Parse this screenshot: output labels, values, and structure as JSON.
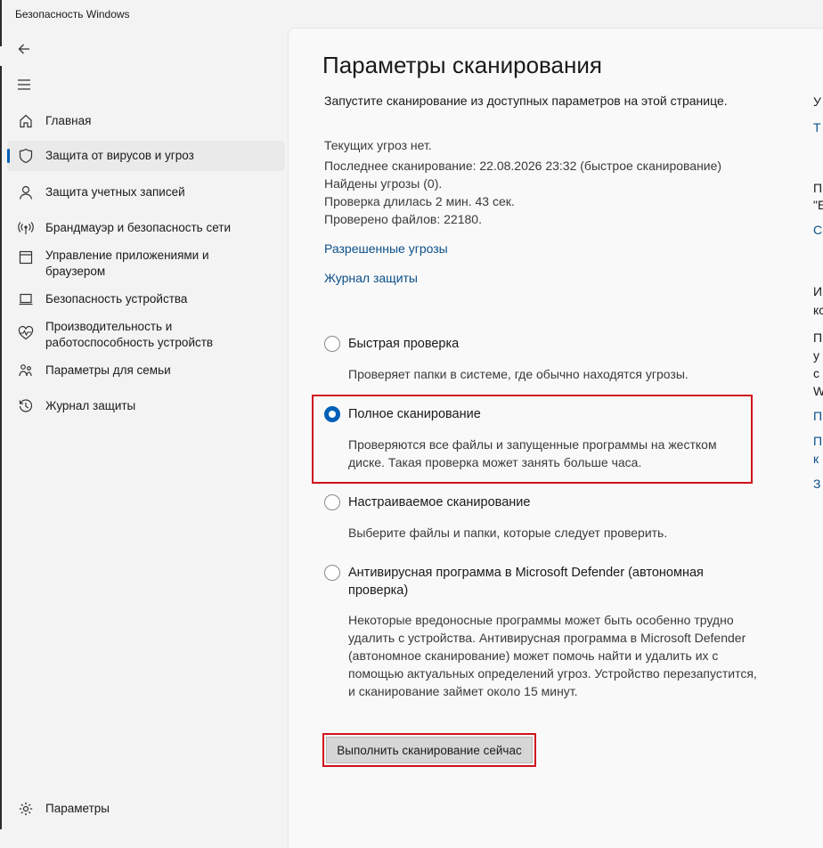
{
  "window": {
    "title": "Безопасность Windows"
  },
  "toolbar": {
    "back_icon": "back-arrow-icon",
    "menu_icon": "hamburger-menu-icon"
  },
  "sidebar": {
    "items": [
      {
        "label": "Главная",
        "icon": "home-icon"
      },
      {
        "label": "Защита от вирусов и угроз",
        "icon": "shield-icon",
        "selected": true
      },
      {
        "label": "Защита учетных записей",
        "icon": "person-icon"
      },
      {
        "label": "Брандмауэр и безопасность сети",
        "icon": "wifi-antenna-icon"
      },
      {
        "label": "Управление приложениями и браузером",
        "icon": "app-browser-icon"
      },
      {
        "label": "Безопасность устройства",
        "icon": "laptop-icon"
      },
      {
        "label": "Производительность и работоспособность устройств",
        "icon": "heart-pulse-icon"
      },
      {
        "label": "Параметры для семьи",
        "icon": "family-icon"
      },
      {
        "label": "Журнал защиты",
        "icon": "history-icon"
      }
    ],
    "settings_label": "Параметры"
  },
  "main": {
    "title": "Параметры сканирования",
    "intro": "Запустите сканирование из доступных параметров на этой странице.",
    "status": [
      "Текущих угроз нет.",
      "Последнее сканирование: 22.08.2026 23:32 (быстрое сканирование)",
      "Найдены угрозы (0).",
      "Проверка длилась 2 мин. 43 сек.",
      "Проверено файлов: 22180."
    ],
    "links": {
      "allowed_threats": "Разрешенные угрозы",
      "protection_history": "Журнал защиты"
    },
    "options": [
      {
        "title": "Быстрая проверка",
        "desc": "Проверяет папки в системе, где обычно находятся угрозы.",
        "checked": false
      },
      {
        "title": "Полное сканирование",
        "desc": "Проверяются все файлы и запущенные программы на жестком диске. Такая проверка может занять больше часа.",
        "checked": true
      },
      {
        "title": "Настраиваемое сканирование",
        "desc": "Выберите файлы и папки, которые следует проверить.",
        "checked": false
      },
      {
        "title": "Антивирусная программа в Microsoft Defender (автономная проверка)",
        "desc": "Некоторые вредоносные программы может быть особенно трудно удалить с устройства. Антивирусная программа в Microsoft Defender (автономное сканирование) может помочь найти и удалить их с помощью актуальных определений угроз. Устройство перезапустится, и сканирование займет около 15 минут.",
        "checked": false
      }
    ],
    "scan_button": "Выполнить сканирование сейчас",
    "highlight_color": "#d0121b",
    "accent_color": "#005fb8"
  },
  "right_panel_clipped": [
    "У",
    "Т",
    "П",
    "\"Е",
    "С",
    "И",
    "кс",
    "П",
    "у",
    "с",
    "W",
    "П",
    "П",
    "к",
    "З"
  ]
}
